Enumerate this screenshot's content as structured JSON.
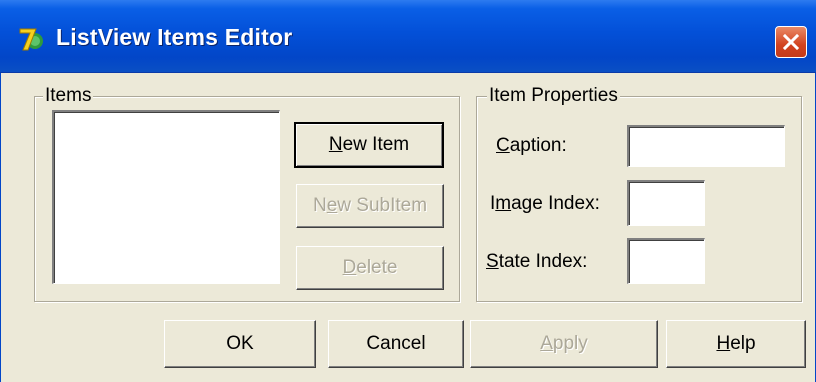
{
  "window": {
    "title": "ListView Items Editor",
    "title_color": "#ffffff",
    "titlebar_color": "#0350d8",
    "close_button_color": "#d2421f"
  },
  "items_group": {
    "label": "Items",
    "list_items": [],
    "buttons": {
      "new_item": {
        "mnemonic": "N",
        "rest": "ew Item",
        "enabled": true,
        "default": true
      },
      "new_subitem": {
        "pre": "N",
        "mnemonic": "e",
        "rest": "w SubItem",
        "enabled": false
      },
      "delete": {
        "mnemonic": "D",
        "rest": "elete",
        "enabled": false
      }
    }
  },
  "properties_group": {
    "label": "Item Properties",
    "caption": {
      "mnemonic": "C",
      "rest": "aption:",
      "value": ""
    },
    "image_index": {
      "pre": "I",
      "mnemonic": "m",
      "rest": "age Index:",
      "value": ""
    },
    "state_index": {
      "mnemonic": "S",
      "rest": "tate Index:",
      "value": ""
    }
  },
  "footer": {
    "ok": "OK",
    "cancel": "Cancel",
    "apply": {
      "mnemonic": "A",
      "rest": "pply",
      "enabled": false
    },
    "help": {
      "mnemonic": "H",
      "rest": "elp",
      "enabled": true
    }
  },
  "icons": {
    "app": "delphi-7-icon",
    "close": "close-x-icon"
  },
  "colors": {
    "dialog_background": "#ece9d8",
    "disabled_text": "#aca899"
  }
}
